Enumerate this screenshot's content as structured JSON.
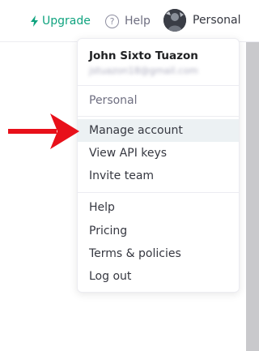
{
  "header": {
    "upgrade_label": "Upgrade",
    "help_label": "Help",
    "help_icon_glyph": "?",
    "profile_label": "Personal"
  },
  "menu": {
    "user_name": "John Sixto Tuazon",
    "user_email": "jstuazon18@gmail.com",
    "org_label": "Personal",
    "account_items": [
      {
        "label": "Manage account"
      },
      {
        "label": "View API keys"
      },
      {
        "label": "Invite team"
      }
    ],
    "support_items": [
      {
        "label": "Help"
      },
      {
        "label": "Pricing"
      },
      {
        "label": "Terms & policies"
      },
      {
        "label": "Log out"
      }
    ]
  },
  "colors": {
    "brand_green": "#10a37f",
    "highlight_bg": "#ecf1f3",
    "annotation_red": "#e8101a"
  },
  "icons": {
    "upgrade": "lightning-bolt-icon",
    "help": "question-circle-icon",
    "arrow": "red-arrow-annotation"
  }
}
